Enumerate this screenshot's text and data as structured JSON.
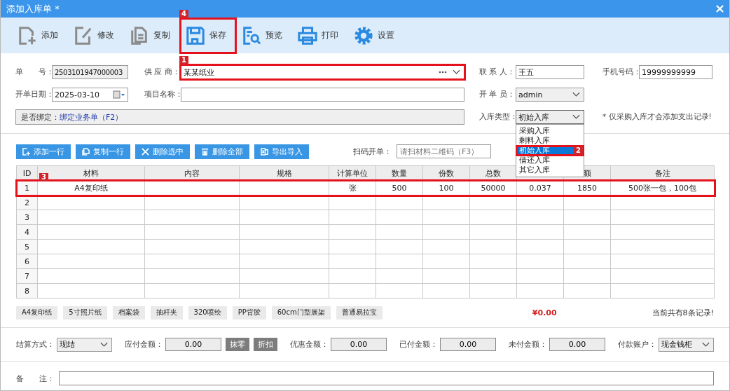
{
  "window": {
    "title": "添加入库单 *"
  },
  "toolbar": [
    {
      "kind": "add",
      "label": "添加",
      "disabled": true
    },
    {
      "kind": "edit",
      "label": "修改",
      "disabled": true
    },
    {
      "kind": "copy",
      "label": "复制",
      "disabled": true
    },
    {
      "kind": "save",
      "label": "保存",
      "disabled": false,
      "annotation": "4"
    },
    {
      "kind": "preview",
      "label": "预览",
      "disabled": false
    },
    {
      "kind": "print",
      "label": "打印",
      "disabled": false
    },
    {
      "kind": "settings",
      "label": "设置",
      "disabled": false
    }
  ],
  "form": {
    "left": [
      [
        {
          "kind": "text",
          "label": "单　　号：",
          "value": "2503101947000003",
          "readonly": true
        },
        {
          "kind": "picker",
          "label": "供 应 商：",
          "value": "某某纸业",
          "annotation": "1"
        }
      ],
      [
        {
          "kind": "date",
          "label": "开单日期：",
          "value": "2025-03-10"
        },
        {
          "kind": "text",
          "label": "项目名称：",
          "readonly": false
        }
      ],
      [
        {
          "kind": "binding",
          "label": "是否绑定：",
          "link": "绑定业务单（F2）"
        }
      ]
    ],
    "right": [
      [
        {
          "kind": "text",
          "label": "联 系 人：",
          "value": "王五",
          "readonly": false
        },
        {
          "kind": "text",
          "label": "手机号码：",
          "value": "19999999999",
          "readonly": false
        }
      ],
      [
        {
          "kind": "select",
          "label": "开 单 员：",
          "value": "admin"
        }
      ],
      [
        {
          "kind": "select",
          "label": "入库类型：",
          "value": "初始入库",
          "expanded": true,
          "options": [
            {
              "label": "采购入库",
              "selected": false
            },
            {
              "label": "剩料入库",
              "selected": false
            },
            {
              "label": "初始入库",
              "selected": true,
              "annotation": "2"
            },
            {
              "label": "借还入库",
              "selected": false
            },
            {
              "label": "其它入库",
              "selected": false
            }
          ]
        },
        {
          "kind": "note",
          "text": "* 仅采购入库才会添加支出记录!"
        }
      ]
    ]
  },
  "grid_buttons": [
    {
      "kind": "add",
      "label": "添加一行"
    },
    {
      "kind": "copy",
      "label": "复制一行"
    },
    {
      "kind": "delete",
      "label": "删除选中"
    },
    {
      "kind": "trash",
      "label": "删除全部"
    },
    {
      "kind": "excel",
      "label": "导出导入"
    }
  ],
  "scan": {
    "label": "扫码开单：",
    "placeholder": "请扫材料二维码（F3）"
  },
  "table": {
    "columns": [
      "ID",
      "材料",
      "内容",
      "规格",
      "计算单位",
      "数量",
      "份数",
      "总数",
      null,
      "额",
      "备注"
    ],
    "rows": [
      {
        "id": "1",
        "annotation": "3",
        "cells": [
          "A4复印纸",
          null,
          null,
          "张",
          "500",
          "100",
          "50000",
          "0.037",
          "1850",
          "500张一包，100包"
        ]
      },
      {
        "id": "2"
      },
      {
        "id": "3"
      },
      {
        "id": "4"
      },
      {
        "id": "5"
      },
      {
        "id": "6"
      },
      {
        "id": "7"
      },
      {
        "id": "8"
      }
    ]
  },
  "tags": [
    "A4复印纸",
    "5寸照片纸",
    "档案袋",
    "抽杆夹",
    "320喷绘",
    "PP背胶",
    "60cm门型展架",
    "普通易拉宝"
  ],
  "total": "¥0.00",
  "record_count": "当前共有8条记录!",
  "settlement": [
    {
      "kind": "select",
      "label": "结算方式：",
      "value": "现结"
    },
    {
      "kind": "amount",
      "label": "应付金额：",
      "value": "0.00",
      "buttons": [
        "抹零",
        "折扣"
      ]
    },
    {
      "kind": "amount",
      "label": "优惠金额：",
      "value": "0.00"
    },
    {
      "kind": "amount",
      "label": "已付金额：",
      "value": "0.00"
    },
    {
      "kind": "amount",
      "label": "未付金额：",
      "value": "0.00"
    },
    {
      "kind": "select",
      "label": "付款账户：",
      "value": "现金钱柜"
    }
  ],
  "remark": {
    "label": "备　　注："
  }
}
